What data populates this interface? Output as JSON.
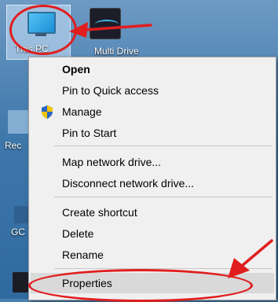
{
  "desktop": {
    "icons": [
      {
        "label": "This PC"
      },
      {
        "label": "Multi Drive"
      },
      {
        "label": "Rec"
      },
      {
        "label": "GC"
      }
    ]
  },
  "context_menu": {
    "items": [
      {
        "label": "Open",
        "bold": true
      },
      {
        "label": "Pin to Quick access"
      },
      {
        "label": "Manage",
        "icon": "shield-icon"
      },
      {
        "label": "Pin to Start"
      },
      {
        "label": "Map network drive..."
      },
      {
        "label": "Disconnect network drive..."
      },
      {
        "label": "Create shortcut"
      },
      {
        "label": "Delete"
      },
      {
        "label": "Rename"
      },
      {
        "label": "Properties"
      }
    ]
  },
  "colors": {
    "annotation": "#e01e1e",
    "menu_background": "#f0f0f0"
  }
}
